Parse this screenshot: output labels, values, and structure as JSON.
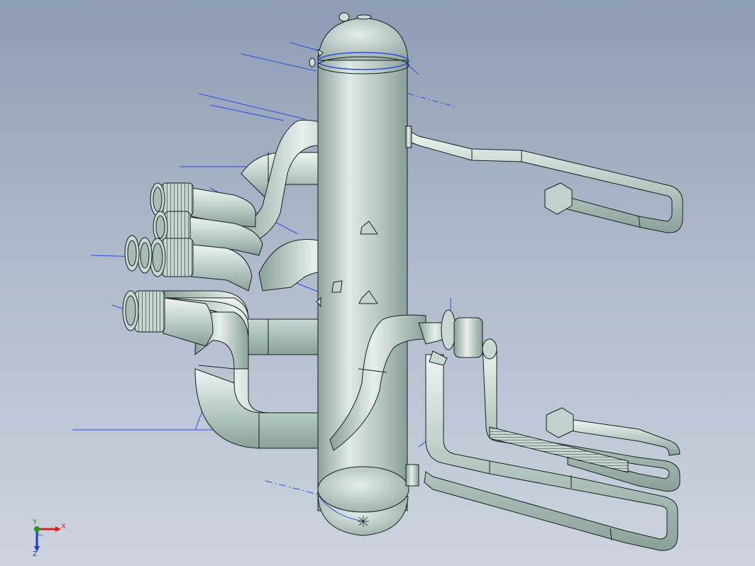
{
  "viewport": {
    "background_top": "#8e9cb4",
    "background_bottom": "#cdd4df"
  },
  "model": {
    "part_color": "#bccdc8",
    "edge_color": "#1a1f1e",
    "sketch_line_color": "#2c4fe0"
  },
  "triad": {
    "x_label": "X",
    "y_label": "Y",
    "z_label": "Z",
    "x_color": "#d22222",
    "y_color": "#1a9a1a",
    "z_color": "#1a3fd0"
  }
}
